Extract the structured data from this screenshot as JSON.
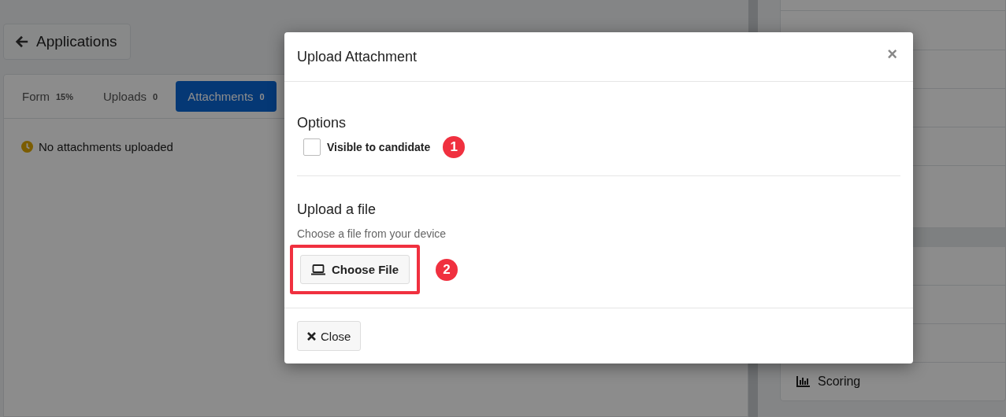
{
  "page": {
    "back_button": {
      "label": "Applications"
    },
    "tabs": [
      {
        "label": "Form",
        "badge": "15%",
        "selected": false
      },
      {
        "label": "Uploads",
        "badge": "0",
        "selected": false
      },
      {
        "label": "Attachments",
        "badge": "0",
        "selected": true
      }
    ],
    "empty_message": "No attachments uploaded",
    "sidebar": {
      "items": [
        {
          "label": "Scoring"
        }
      ]
    }
  },
  "modal": {
    "title": "Upload Attachment",
    "close_glyph": "×",
    "options": {
      "heading": "Options",
      "checkbox": {
        "label": "Visible to candidate",
        "checked": false
      },
      "annotation": "1"
    },
    "upload": {
      "heading": "Upload a file",
      "hint": "Choose a file from your device",
      "button": "Choose File",
      "highlighted": true,
      "annotation": "2"
    },
    "footer": {
      "close_button": "Close"
    }
  }
}
